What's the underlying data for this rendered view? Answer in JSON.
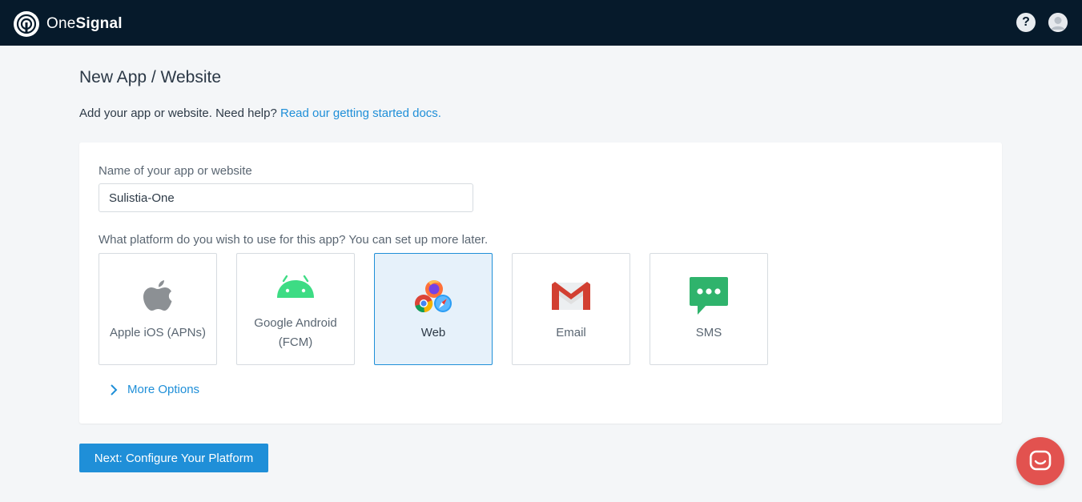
{
  "brand": {
    "name_light": "One",
    "name_bold": "Signal"
  },
  "header": {
    "help_label": "?"
  },
  "page": {
    "title": "New App / Website",
    "intro_text": "Add your app or website. Need help?",
    "intro_link": "Read our getting started docs."
  },
  "form": {
    "name_label": "Name of your app or website",
    "name_value": "Sulistia-One",
    "platform_question": "What platform do you wish to use for this app? You can set up more later.",
    "platforms": [
      {
        "label": "Apple iOS (APNs)",
        "icon": "apple-icon",
        "selected": false
      },
      {
        "label": "Google Android (FCM)",
        "icon": "android-icon",
        "selected": false
      },
      {
        "label": "Web",
        "icon": "browsers-icon",
        "selected": true
      },
      {
        "label": "Email",
        "icon": "gmail-icon",
        "selected": false
      },
      {
        "label": "SMS",
        "icon": "sms-icon",
        "selected": false
      }
    ],
    "more_options_label": "More Options"
  },
  "actions": {
    "next_label": "Next: Configure Your Platform"
  },
  "colors": {
    "accent": "#1f8fd8",
    "topbar": "#061a2b",
    "chat": "#e2524f"
  }
}
